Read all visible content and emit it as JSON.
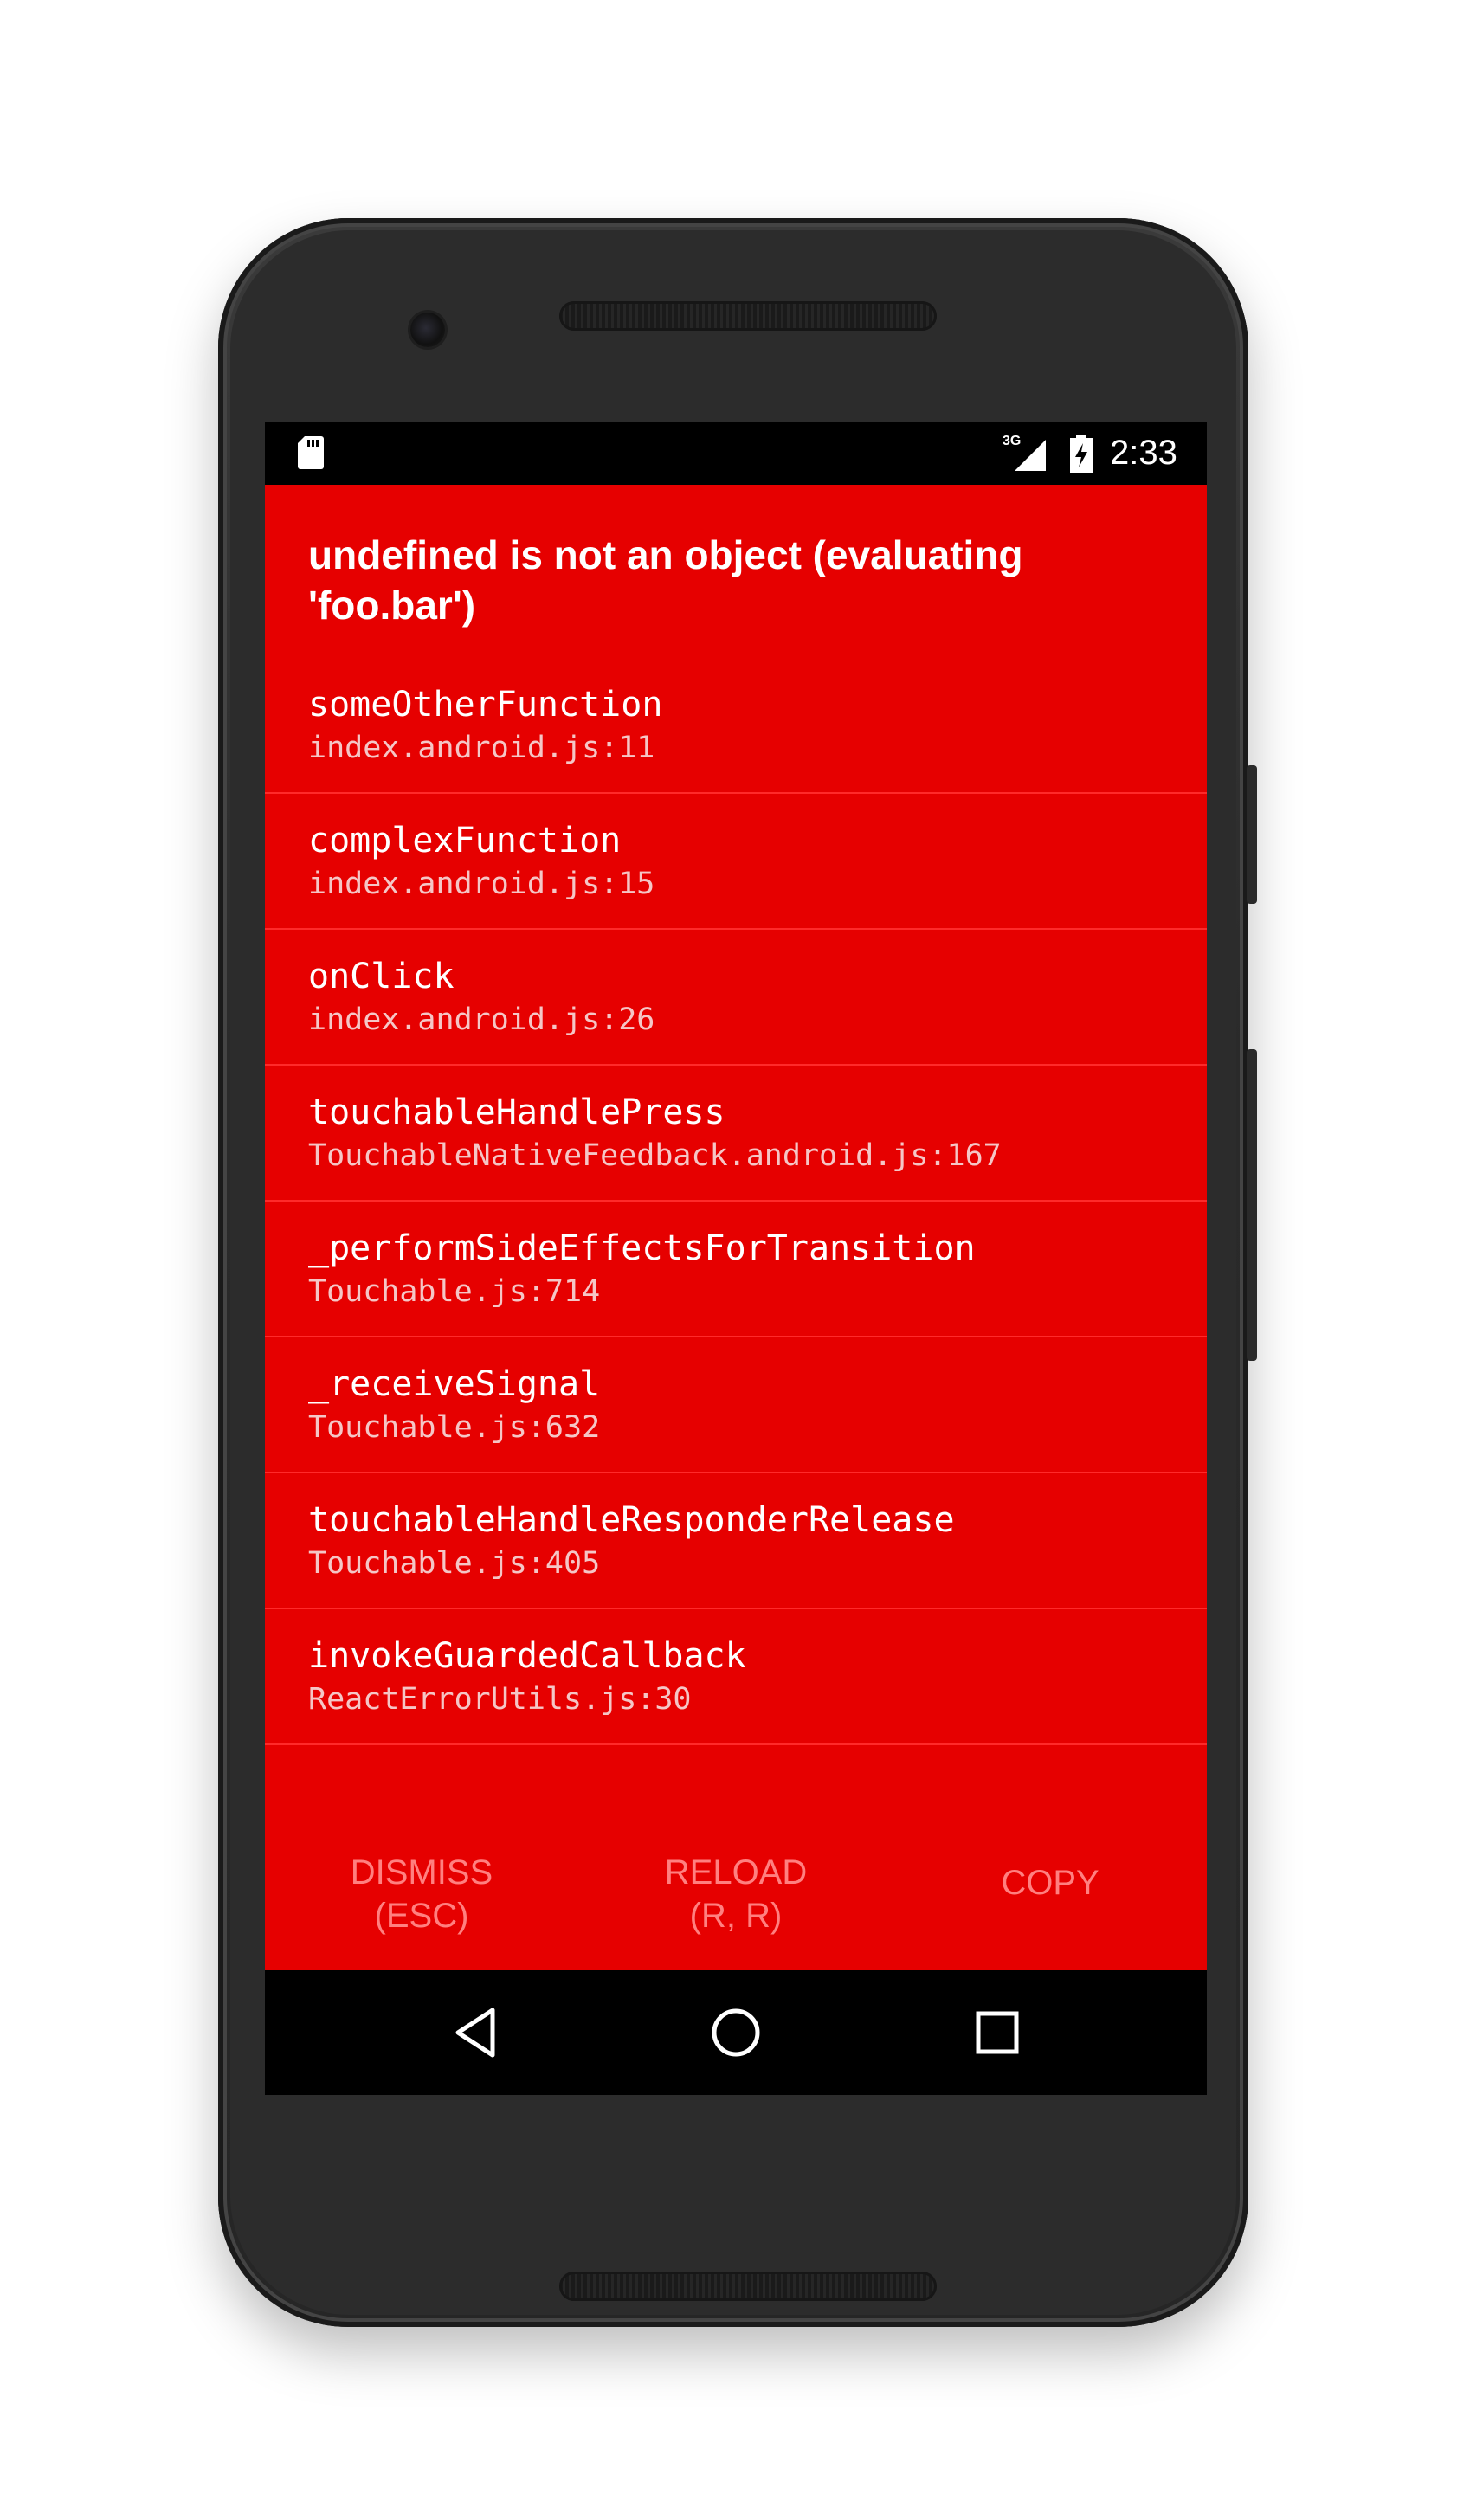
{
  "status_bar": {
    "network": "3G",
    "time": "2:33"
  },
  "redbox": {
    "title": "undefined is not an object (evaluating 'foo.bar')",
    "frames": [
      {
        "method": "someOtherFunction",
        "file": "index.android.js:11"
      },
      {
        "method": "complexFunction",
        "file": "index.android.js:15"
      },
      {
        "method": "onClick",
        "file": "index.android.js:26"
      },
      {
        "method": "touchableHandlePress",
        "file": "TouchableNativeFeedback.android.js:167"
      },
      {
        "method": "_performSideEffectsForTransition",
        "file": "Touchable.js:714"
      },
      {
        "method": "_receiveSignal",
        "file": "Touchable.js:632"
      },
      {
        "method": "touchableHandleResponderRelease",
        "file": "Touchable.js:405"
      },
      {
        "method": "invokeGuardedCallback",
        "file": "ReactErrorUtils.js:30"
      }
    ],
    "buttons": {
      "dismiss": {
        "line1": "DISMISS",
        "line2": "(ESC)"
      },
      "reload": {
        "line1": "RELOAD",
        "line2": "(R, R)"
      },
      "copy": {
        "line1": "COPY",
        "line2": ""
      }
    }
  },
  "nav_bar": {
    "icons": [
      "back-icon",
      "home-icon",
      "recents-icon"
    ]
  },
  "colors": {
    "redbox_background": "#e60000",
    "button_text": "#ff8080",
    "divider": "#ff2a2a"
  }
}
